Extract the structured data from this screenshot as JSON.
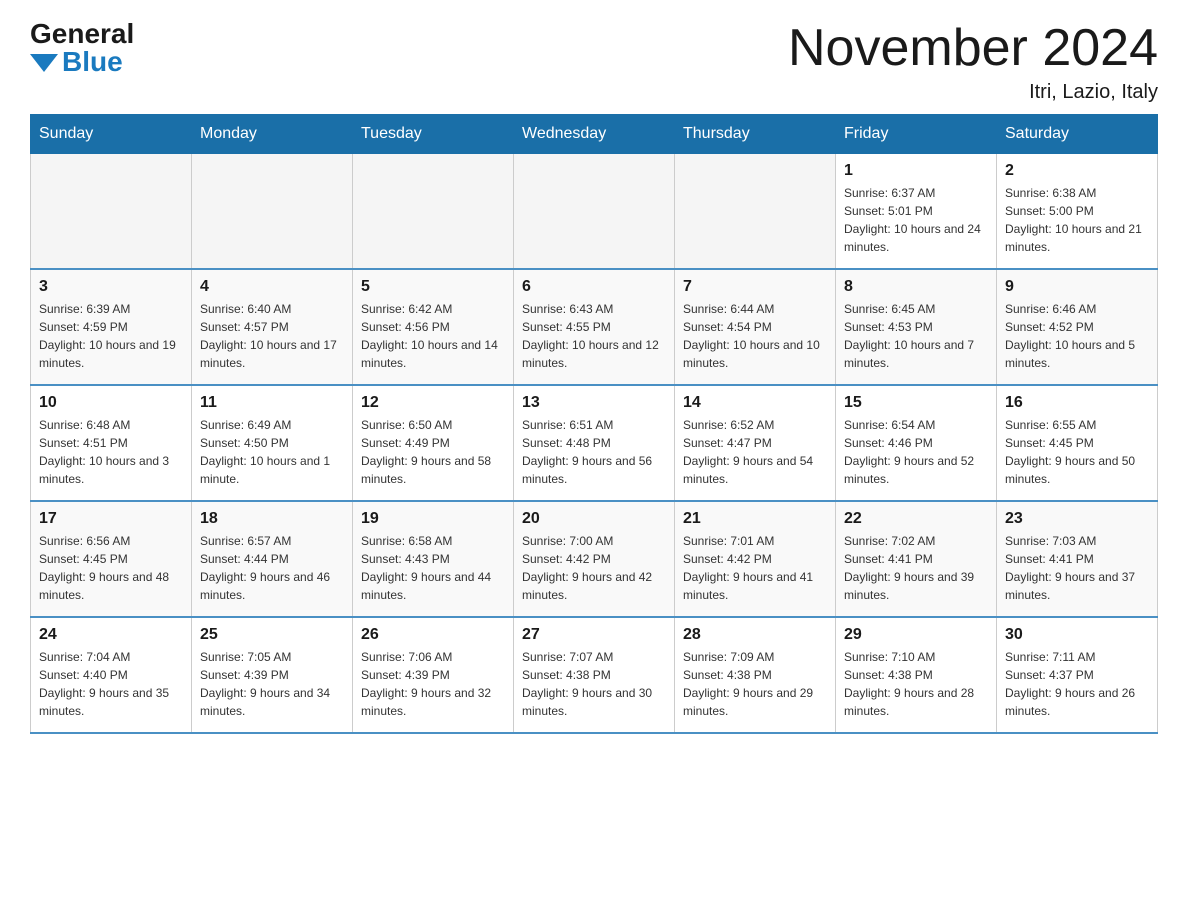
{
  "logo": {
    "general": "General",
    "blue": "Blue"
  },
  "title": "November 2024",
  "subtitle": "Itri, Lazio, Italy",
  "weekdays": [
    "Sunday",
    "Monday",
    "Tuesday",
    "Wednesday",
    "Thursday",
    "Friday",
    "Saturday"
  ],
  "weeks": [
    [
      {
        "day": "",
        "info": ""
      },
      {
        "day": "",
        "info": ""
      },
      {
        "day": "",
        "info": ""
      },
      {
        "day": "",
        "info": ""
      },
      {
        "day": "",
        "info": ""
      },
      {
        "day": "1",
        "info": "Sunrise: 6:37 AM\nSunset: 5:01 PM\nDaylight: 10 hours and 24 minutes."
      },
      {
        "day": "2",
        "info": "Sunrise: 6:38 AM\nSunset: 5:00 PM\nDaylight: 10 hours and 21 minutes."
      }
    ],
    [
      {
        "day": "3",
        "info": "Sunrise: 6:39 AM\nSunset: 4:59 PM\nDaylight: 10 hours and 19 minutes."
      },
      {
        "day": "4",
        "info": "Sunrise: 6:40 AM\nSunset: 4:57 PM\nDaylight: 10 hours and 17 minutes."
      },
      {
        "day": "5",
        "info": "Sunrise: 6:42 AM\nSunset: 4:56 PM\nDaylight: 10 hours and 14 minutes."
      },
      {
        "day": "6",
        "info": "Sunrise: 6:43 AM\nSunset: 4:55 PM\nDaylight: 10 hours and 12 minutes."
      },
      {
        "day": "7",
        "info": "Sunrise: 6:44 AM\nSunset: 4:54 PM\nDaylight: 10 hours and 10 minutes."
      },
      {
        "day": "8",
        "info": "Sunrise: 6:45 AM\nSunset: 4:53 PM\nDaylight: 10 hours and 7 minutes."
      },
      {
        "day": "9",
        "info": "Sunrise: 6:46 AM\nSunset: 4:52 PM\nDaylight: 10 hours and 5 minutes."
      }
    ],
    [
      {
        "day": "10",
        "info": "Sunrise: 6:48 AM\nSunset: 4:51 PM\nDaylight: 10 hours and 3 minutes."
      },
      {
        "day": "11",
        "info": "Sunrise: 6:49 AM\nSunset: 4:50 PM\nDaylight: 10 hours and 1 minute."
      },
      {
        "day": "12",
        "info": "Sunrise: 6:50 AM\nSunset: 4:49 PM\nDaylight: 9 hours and 58 minutes."
      },
      {
        "day": "13",
        "info": "Sunrise: 6:51 AM\nSunset: 4:48 PM\nDaylight: 9 hours and 56 minutes."
      },
      {
        "day": "14",
        "info": "Sunrise: 6:52 AM\nSunset: 4:47 PM\nDaylight: 9 hours and 54 minutes."
      },
      {
        "day": "15",
        "info": "Sunrise: 6:54 AM\nSunset: 4:46 PM\nDaylight: 9 hours and 52 minutes."
      },
      {
        "day": "16",
        "info": "Sunrise: 6:55 AM\nSunset: 4:45 PM\nDaylight: 9 hours and 50 minutes."
      }
    ],
    [
      {
        "day": "17",
        "info": "Sunrise: 6:56 AM\nSunset: 4:45 PM\nDaylight: 9 hours and 48 minutes."
      },
      {
        "day": "18",
        "info": "Sunrise: 6:57 AM\nSunset: 4:44 PM\nDaylight: 9 hours and 46 minutes."
      },
      {
        "day": "19",
        "info": "Sunrise: 6:58 AM\nSunset: 4:43 PM\nDaylight: 9 hours and 44 minutes."
      },
      {
        "day": "20",
        "info": "Sunrise: 7:00 AM\nSunset: 4:42 PM\nDaylight: 9 hours and 42 minutes."
      },
      {
        "day": "21",
        "info": "Sunrise: 7:01 AM\nSunset: 4:42 PM\nDaylight: 9 hours and 41 minutes."
      },
      {
        "day": "22",
        "info": "Sunrise: 7:02 AM\nSunset: 4:41 PM\nDaylight: 9 hours and 39 minutes."
      },
      {
        "day": "23",
        "info": "Sunrise: 7:03 AM\nSunset: 4:41 PM\nDaylight: 9 hours and 37 minutes."
      }
    ],
    [
      {
        "day": "24",
        "info": "Sunrise: 7:04 AM\nSunset: 4:40 PM\nDaylight: 9 hours and 35 minutes."
      },
      {
        "day": "25",
        "info": "Sunrise: 7:05 AM\nSunset: 4:39 PM\nDaylight: 9 hours and 34 minutes."
      },
      {
        "day": "26",
        "info": "Sunrise: 7:06 AM\nSunset: 4:39 PM\nDaylight: 9 hours and 32 minutes."
      },
      {
        "day": "27",
        "info": "Sunrise: 7:07 AM\nSunset: 4:38 PM\nDaylight: 9 hours and 30 minutes."
      },
      {
        "day": "28",
        "info": "Sunrise: 7:09 AM\nSunset: 4:38 PM\nDaylight: 9 hours and 29 minutes."
      },
      {
        "day": "29",
        "info": "Sunrise: 7:10 AM\nSunset: 4:38 PM\nDaylight: 9 hours and 28 minutes."
      },
      {
        "day": "30",
        "info": "Sunrise: 7:11 AM\nSunset: 4:37 PM\nDaylight: 9 hours and 26 minutes."
      }
    ]
  ]
}
